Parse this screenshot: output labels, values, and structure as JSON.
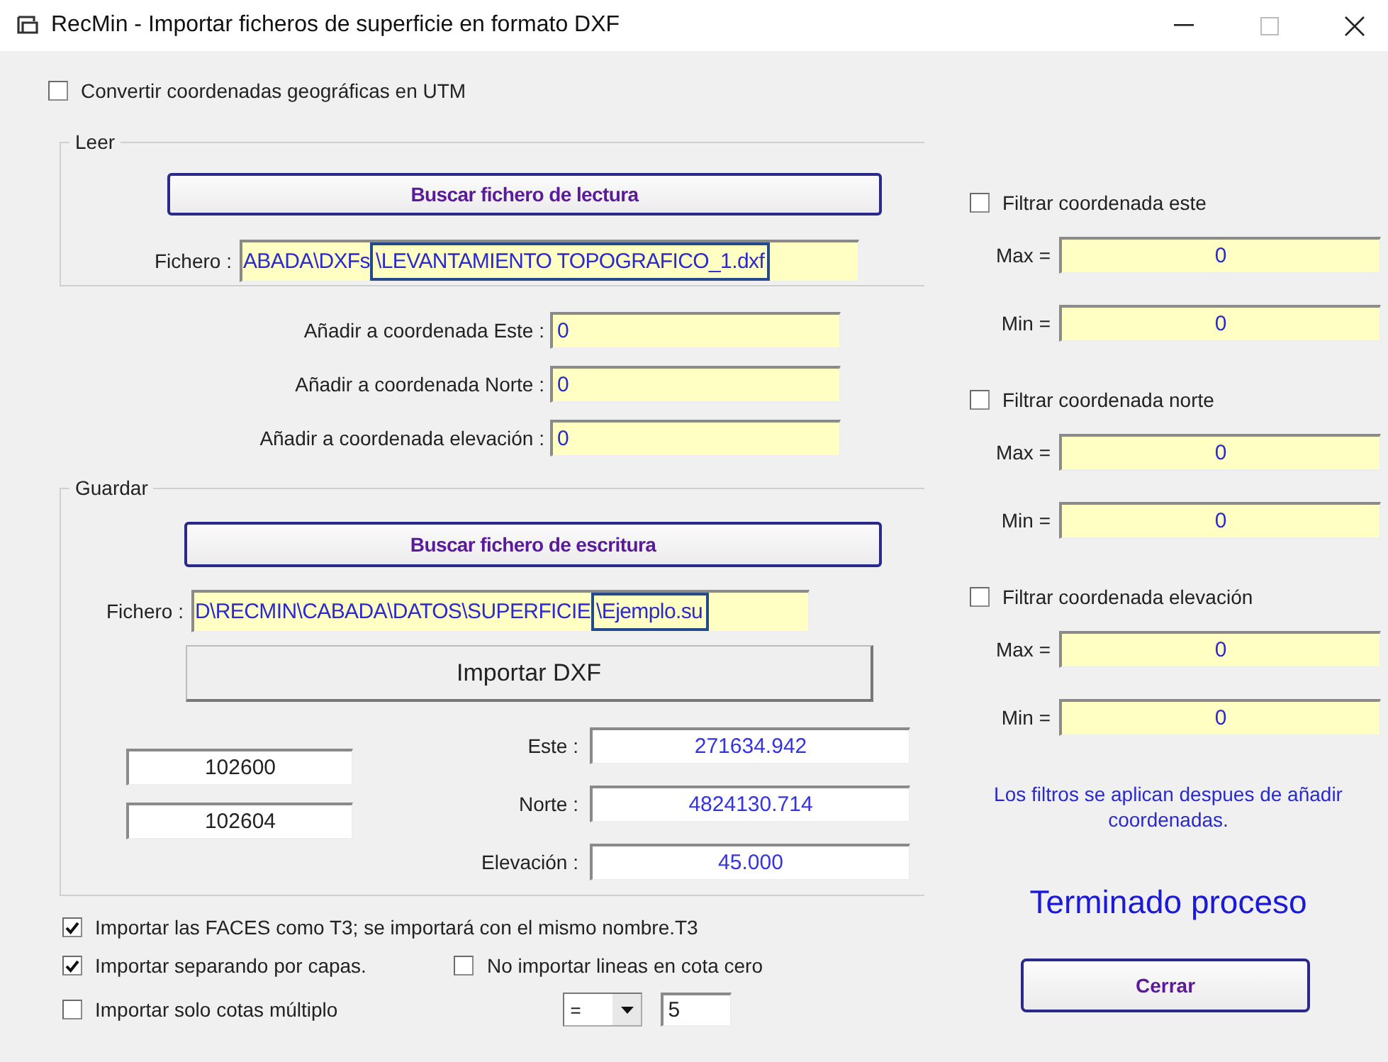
{
  "window": {
    "title": "RecMin - Importar ficheros de superficie en formato DXF"
  },
  "utm": {
    "label": "Convertir coordenadas geográficas en UTM",
    "checked": false
  },
  "read": {
    "legend": "Leer",
    "button": "Buscar fichero de lectura",
    "file_label": "Fichero :",
    "file_parts": [
      {
        "text": "ABADA\\DXFs",
        "highlighted": false
      },
      {
        "text": "\\LEVANTAMIENTO TOPOGRAFICO_1.dxf",
        "highlighted": true
      }
    ]
  },
  "offsets": [
    {
      "label": "Añadir a coordenada Este :",
      "value": "0"
    },
    {
      "label": "Añadir a coordenada Norte :",
      "value": "0"
    },
    {
      "label": "Añadir a coordenada elevación :",
      "value": "0"
    }
  ],
  "save": {
    "legend": "Guardar",
    "button": "Buscar fichero de escritura",
    "file_label": "Fichero :",
    "file_parts": [
      {
        "text": "D\\RECMIN\\CABADA\\DATOS\\SUPERFICIE",
        "highlighted": false
      },
      {
        "text": "\\Ejemplo.su",
        "highlighted": true
      }
    ],
    "import_button": "Importar DXF",
    "counters": [
      "102600",
      "102604"
    ],
    "coords": [
      {
        "label": "Este :",
        "value": "271634.942"
      },
      {
        "label": "Norte :",
        "value": "4824130.714"
      },
      {
        "label": "Elevación :",
        "value": "45.000"
      }
    ]
  },
  "options": {
    "faces": {
      "label": "Importar las FACES como T3; se importará con el mismo nombre.T3",
      "checked": true
    },
    "layers": {
      "label": "Importar separando por capas.",
      "checked": true
    },
    "zero": {
      "label": "No importar lineas en cota cero",
      "checked": false
    },
    "multiple": {
      "label": "Importar solo cotas múltiplo",
      "checked": false,
      "operator": "=",
      "value": "5"
    }
  },
  "filters": [
    {
      "label": "Filtrar coordenada este",
      "checked": false,
      "max_label": "Max =",
      "max": "0",
      "min_label": "Min =",
      "min": "0"
    },
    {
      "label": "Filtrar coordenada norte",
      "checked": false,
      "max_label": "Max =",
      "max": "0",
      "min_label": "Min =",
      "min": "0"
    },
    {
      "label": "Filtrar coordenada elevación",
      "checked": false,
      "max_label": "Max =",
      "max": "0",
      "min_label": "Min =",
      "min": "0"
    }
  ],
  "note": "Los filtros se aplican despues de añadir coordenadas.",
  "status": "Terminado proceso",
  "close_button": "Cerrar"
}
